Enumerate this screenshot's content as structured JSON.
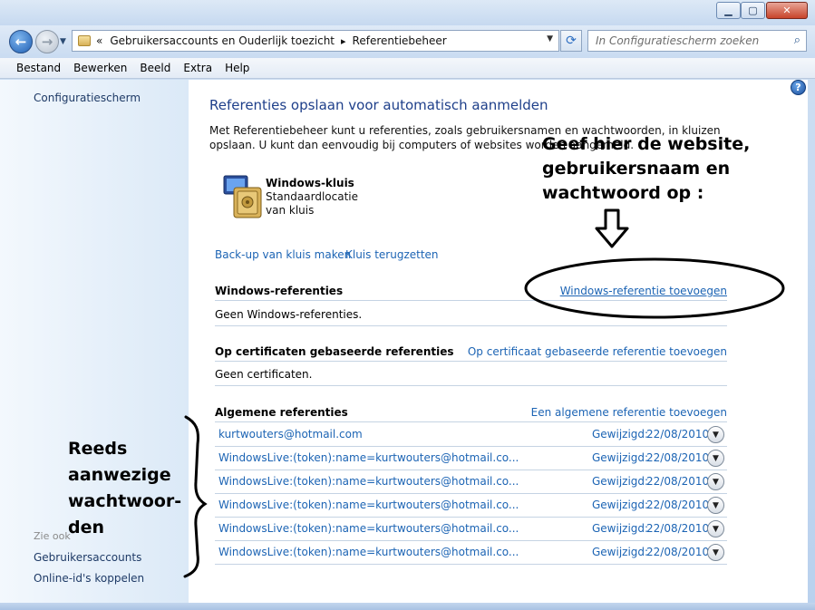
{
  "window": {
    "minimize_icon": "minimize-icon",
    "maximize_icon": "maximize-icon",
    "close_icon": "close-icon"
  },
  "navbar": {
    "back_icon": "arrow-left-icon",
    "forward_icon": "arrow-right-icon",
    "breadcrumb_prefix": "«",
    "breadcrumb": [
      "Gebruikersaccounts en Ouderlijk toezicht",
      "Referentiebeheer"
    ],
    "breadcrumb_separator": "▸",
    "search_placeholder": "In Configuratiescherm zoeken"
  },
  "menu": [
    "Bestand",
    "Bewerken",
    "Beeld",
    "Extra",
    "Help"
  ],
  "sidebar": {
    "home_link": "Configuratiescherm",
    "see_also_label": "Zie ook",
    "see_also_links": [
      "Gebruikersaccounts",
      "Online-id's koppelen"
    ]
  },
  "main": {
    "help_icon": "question-icon",
    "title": "Referenties opslaan voor automatisch aanmelden",
    "intro": "Met Referentiebeheer kunt u referenties, zoals gebruikersnamen en wachtwoorden, in kluizen opslaan. U kunt dan eenvoudig bij computers of websites worden aangemeld.",
    "vault": {
      "name": "Windows-kluis",
      "description": "Standaardlocatie van kluis"
    },
    "backup_link": "Back-up van kluis maken",
    "restore_link": "Kluis terugzetten",
    "windows_section": {
      "label": "Windows-referenties",
      "add_link": "Windows-referentie toevoegen",
      "empty_text": "Geen Windows-referenties."
    },
    "cert_section": {
      "label": "Op certificaten gebaseerde referenties",
      "add_link": "Op certificaat gebaseerde referentie toevoegen",
      "empty_text": "Geen certificaten."
    },
    "generic_section": {
      "label": "Algemene referenties",
      "add_link": "Een algemene referentie toevoegen",
      "items": [
        {
          "name": "kurtwouters@hotmail.com",
          "modified_label": "Gewijzigd:",
          "modified": "22/08/2010"
        },
        {
          "name": "WindowsLive:(token):name=kurtwouters@hotmail.co...",
          "modified_label": "Gewijzigd:",
          "modified": "22/08/2010"
        },
        {
          "name": "WindowsLive:(token):name=kurtwouters@hotmail.co...",
          "modified_label": "Gewijzigd:",
          "modified": "22/08/2010"
        },
        {
          "name": "WindowsLive:(token):name=kurtwouters@hotmail.co...",
          "modified_label": "Gewijzigd:",
          "modified": "22/08/2010"
        },
        {
          "name": "WindowsLive:(token):name=kurtwouters@hotmail.co...",
          "modified_label": "Gewijzigd:",
          "modified": "22/08/2010"
        },
        {
          "name": "WindowsLive:(token):name=kurtwouters@hotmail.co...",
          "modified_label": "Gewijzigd:",
          "modified": "22/08/2010"
        }
      ]
    }
  },
  "annotations": {
    "top_lines": [
      "Geef hier de website,",
      "gebruikersnaam en",
      "wachtwoord op :"
    ],
    "left_lines": [
      "Reeds",
      "aanwezige",
      "wachtwoor-",
      "den"
    ]
  },
  "colors": {
    "link": "#1c64b4",
    "title": "#1e3f8a",
    "sidebar_bg": "#dbe9f7"
  }
}
